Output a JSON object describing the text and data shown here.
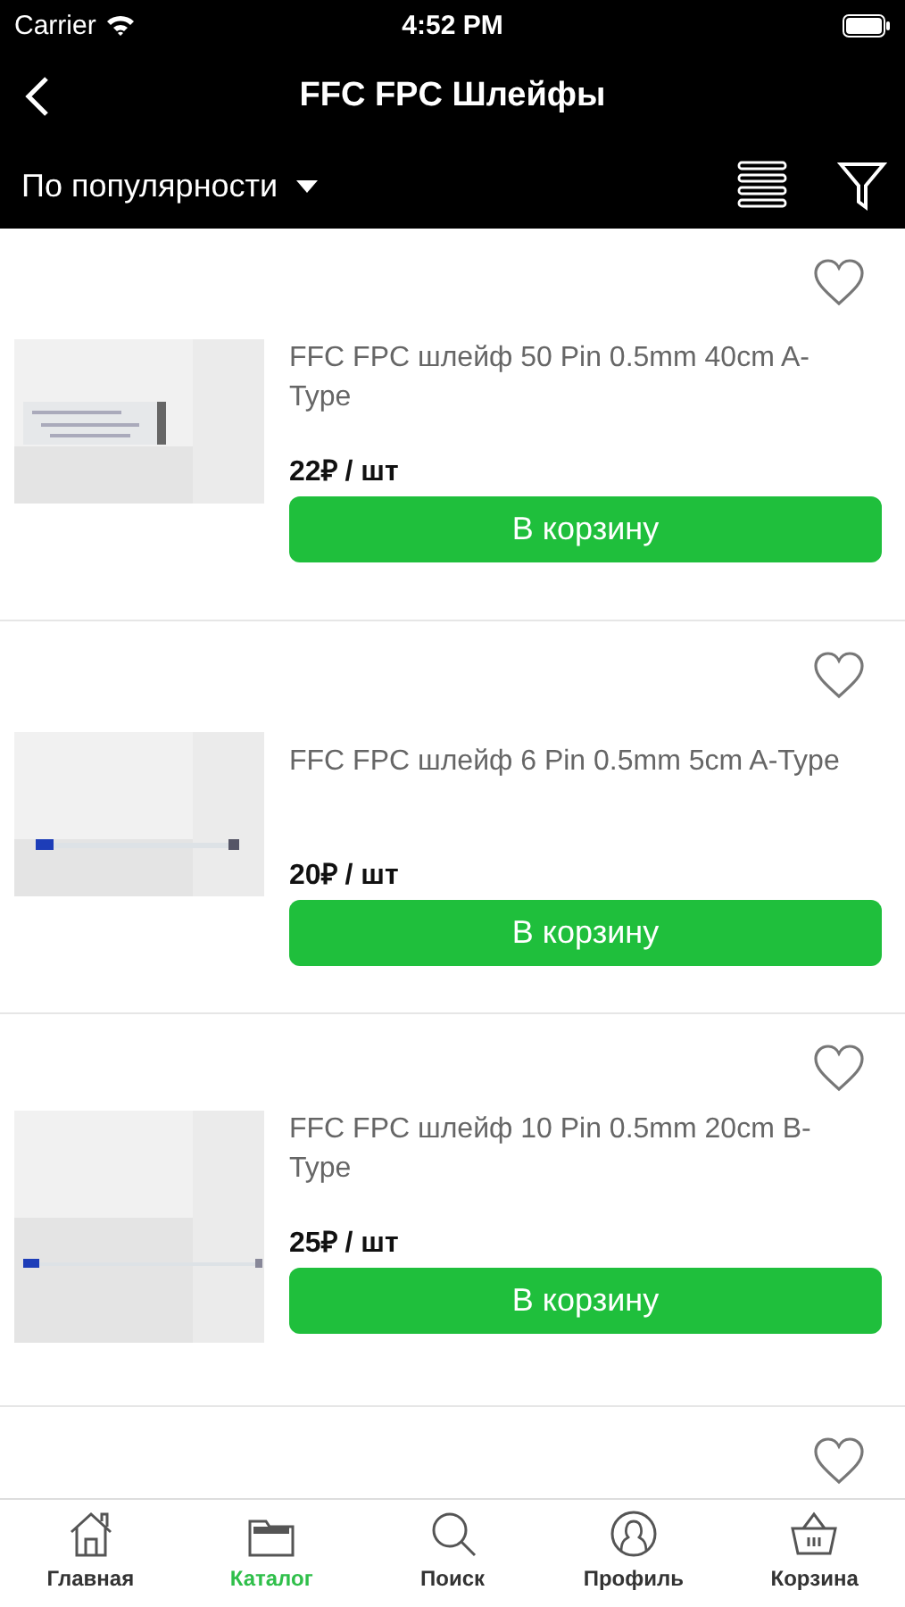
{
  "status_bar": {
    "carrier": "Carrier",
    "time": "4:52 PM"
  },
  "nav": {
    "title": "FFC FPC Шлейфы"
  },
  "sort": {
    "label": "По популярности"
  },
  "products": [
    {
      "title": "FFC FPC шлейф 50 Pin 0.5mm 40cm A-Type",
      "price": "22₽ / шт",
      "button": "В корзину",
      "favorite": false
    },
    {
      "title": "FFC FPC шлейф 6 Pin 0.5mm 5cm A-Type",
      "price": "20₽ / шт",
      "button": "В корзину",
      "favorite": false
    },
    {
      "title": "FFC FPC шлейф 10 Pin 0.5mm 20cm B-Type",
      "price": "25₽ / шт",
      "button": "В корзину",
      "favorite": false
    }
  ],
  "next_product": {
    "favorite": false
  },
  "tabs": [
    {
      "label": "Главная",
      "selected": false
    },
    {
      "label": "Каталог",
      "selected": true
    },
    {
      "label": "Поиск",
      "selected": false
    },
    {
      "label": "Профиль",
      "selected": false
    },
    {
      "label": "Корзина",
      "selected": false
    }
  ]
}
